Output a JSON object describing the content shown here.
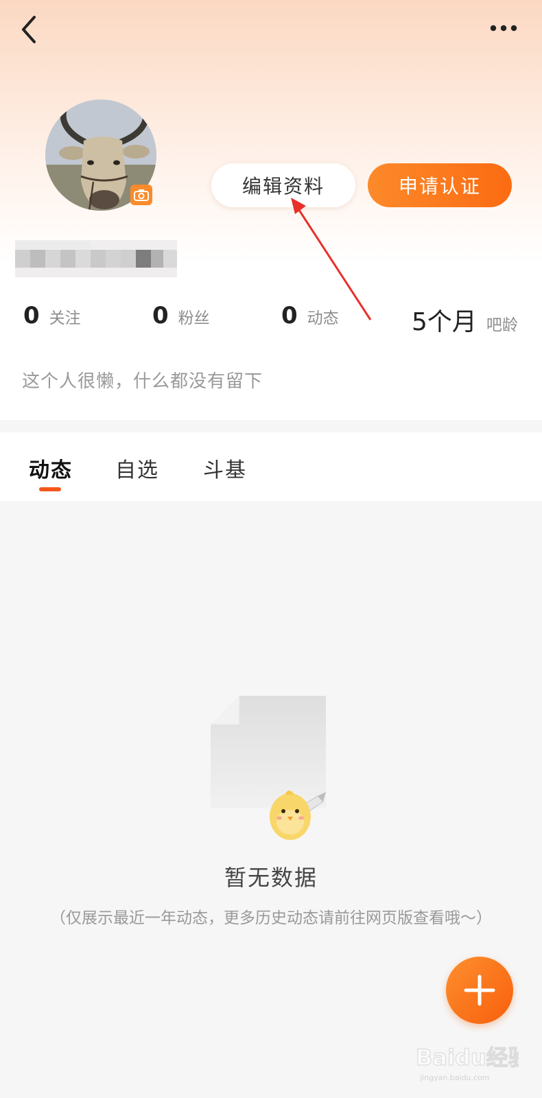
{
  "header": {
    "back_icon": "chevron-left-icon",
    "more_icon": "more-horizontal-icon"
  },
  "profile": {
    "avatar_badge_icon": "camera-icon",
    "edit_button": "编辑资料",
    "verify_button": "申请认证",
    "bio": "这个人很懒，什么都没有留下"
  },
  "stats": [
    {
      "value": "0",
      "label": "关注"
    },
    {
      "value": "0",
      "label": "粉丝"
    },
    {
      "value": "0",
      "label": "动态"
    },
    {
      "value": "5个月",
      "label": "吧龄"
    }
  ],
  "tabs": [
    {
      "label": "动态",
      "active": true
    },
    {
      "label": "自选",
      "active": false
    },
    {
      "label": "斗基",
      "active": false
    }
  ],
  "empty_state": {
    "title": "暂无数据",
    "subtitle": "（仅展示最近一年动态，更多历史动态请前往网页版查看哦～）"
  },
  "fab": {
    "icon": "plus-icon"
  },
  "watermark": {
    "brand": "Baidu经验",
    "url": "jingyan.baidu.com"
  },
  "colors": {
    "accent": "#fb6b12",
    "tab_indicator": "#f4561c",
    "annotation_arrow": "#e8302a"
  }
}
